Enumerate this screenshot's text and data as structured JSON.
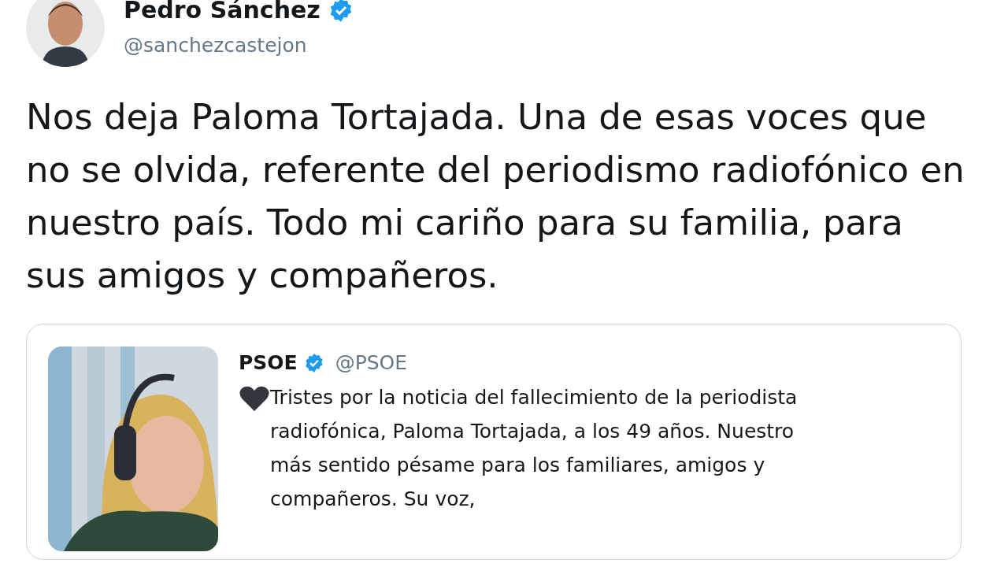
{
  "author": {
    "name": "Pedro Sánchez",
    "verified": true,
    "handle": "@sanchezcastejon"
  },
  "tweet_text": "Nos deja Paloma Tortajada. Una de esas voces que no se olvida, referente del periodismo radiofónico en nuestro país. Todo mi cariño para su familia, para sus amigos y compañeros.",
  "quoted_tweet": {
    "name": "PSOE",
    "verified": true,
    "handle": "@PSOE",
    "text": "Tristes por la noticia del fallecimiento de la periodista radiofónica, Paloma Tortajada, a los 49 años. Nuestro más sentido pésame para los familiares, amigos y compañeros. Su voz,"
  }
}
